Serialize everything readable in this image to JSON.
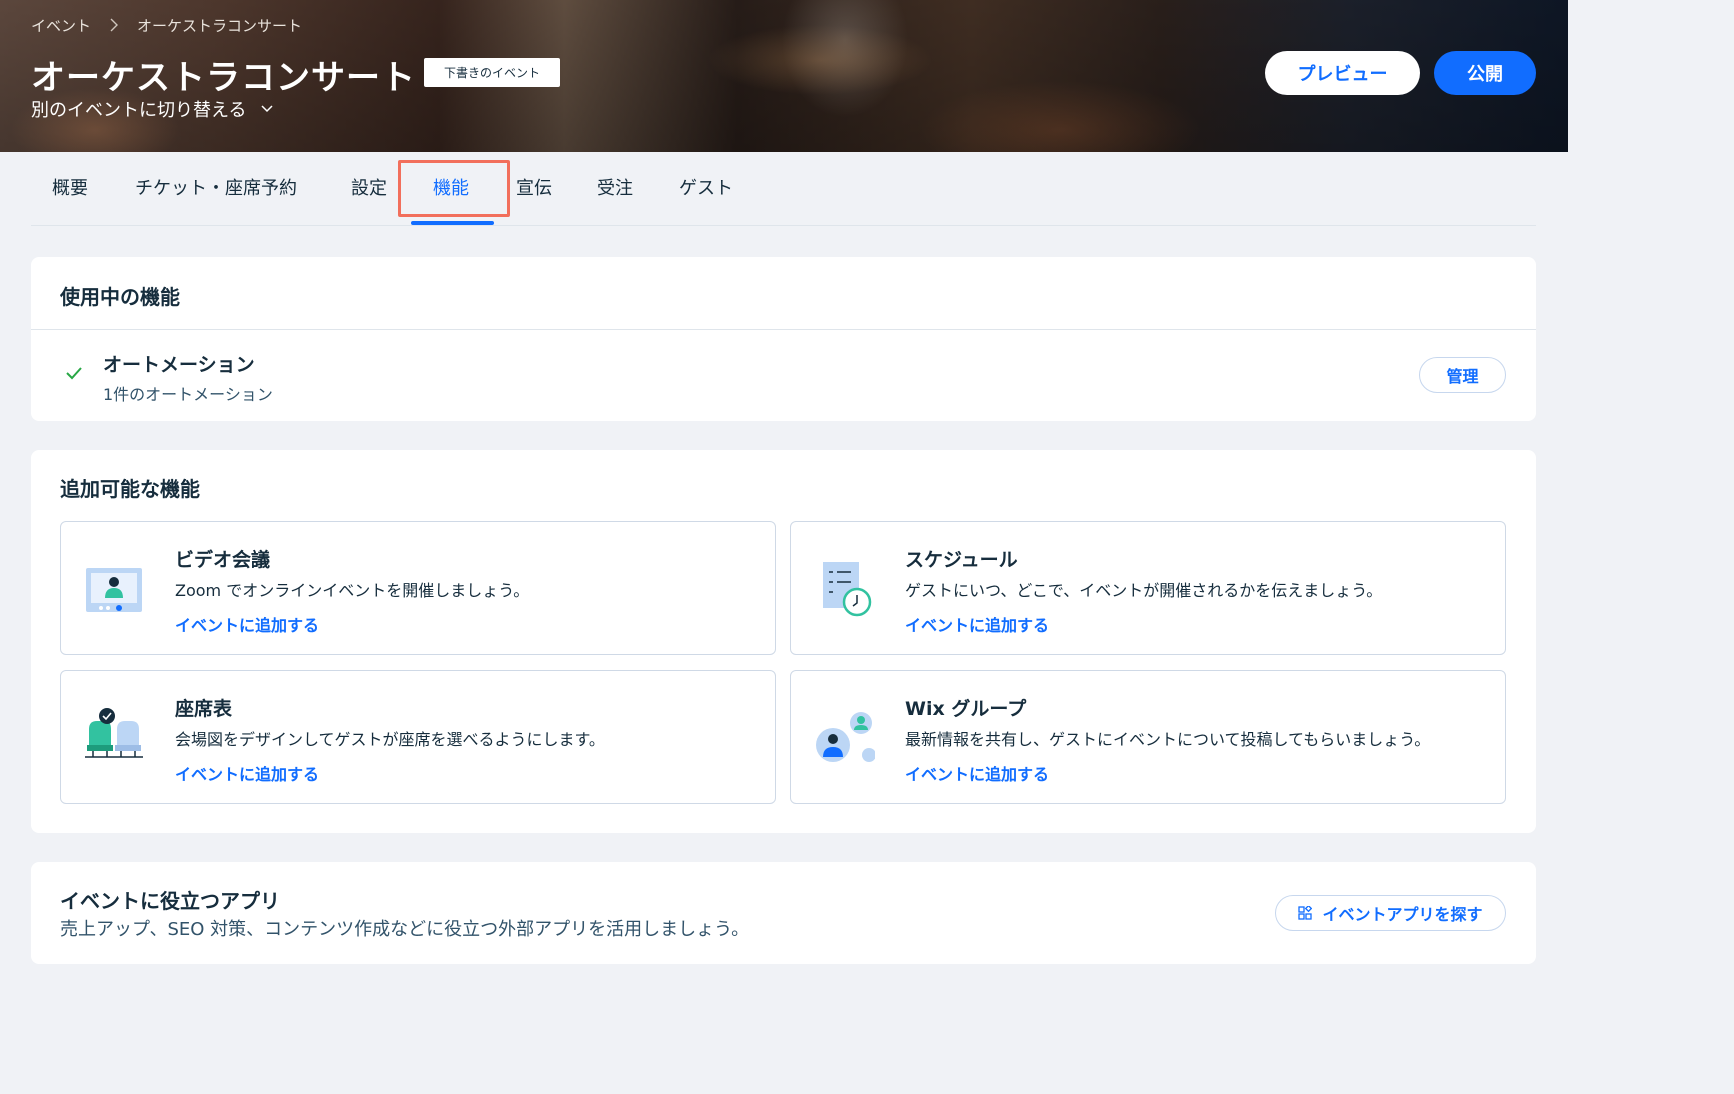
{
  "header": {
    "breadcrumb": [
      "イベント",
      "オーケストラコンサート"
    ],
    "title": "オーケストラコンサート",
    "badge": "下書きのイベント",
    "switch_event": "別のイベントに切り替える",
    "preview_label": "プレビュー",
    "publish_label": "公開"
  },
  "tabs": [
    {
      "label": "概要"
    },
    {
      "label": "チケット・座席予約"
    },
    {
      "label": "設定"
    },
    {
      "label": "機能",
      "active": true
    },
    {
      "label": "宣伝"
    },
    {
      "label": "受注"
    },
    {
      "label": "ゲスト"
    }
  ],
  "active_features": {
    "title": "使用中の機能",
    "items": [
      {
        "name": "オートメーション",
        "sub": "1件のオートメーション",
        "action": "管理"
      }
    ]
  },
  "available_features": {
    "title": "追加可能な機能",
    "items": [
      {
        "title": "ビデオ会議",
        "desc": "Zoom でオンラインイベントを開催しましょう。",
        "link": "イベントに追加する",
        "icon": "video-conference-icon"
      },
      {
        "title": "スケジュール",
        "desc": "ゲストにいつ、どこで、イベントが開催されるかを伝えましょう。",
        "link": "イベントに追加する",
        "icon": "schedule-icon"
      },
      {
        "title": "座席表",
        "desc": "会場図をデザインしてゲストが座席を選べるようにします。",
        "link": "イベントに追加する",
        "icon": "seating-chart-icon"
      },
      {
        "title": "Wix グループ",
        "desc": "最新情報を共有し、ゲストにイベントについて投稿してもらいましょう。",
        "link": "イベントに追加する",
        "icon": "wix-groups-icon"
      }
    ]
  },
  "apps": {
    "title": "イベントに役立つアプリ",
    "desc": "売上アップ、SEO 対策、コンテンツ作成などに役立つ外部アプリを活用しましょう。",
    "button": "イベントアプリを探す"
  },
  "colors": {
    "accent": "#116dff",
    "highlight": "#f26f5c",
    "check": "#28a745",
    "teal": "#32c2a0"
  }
}
